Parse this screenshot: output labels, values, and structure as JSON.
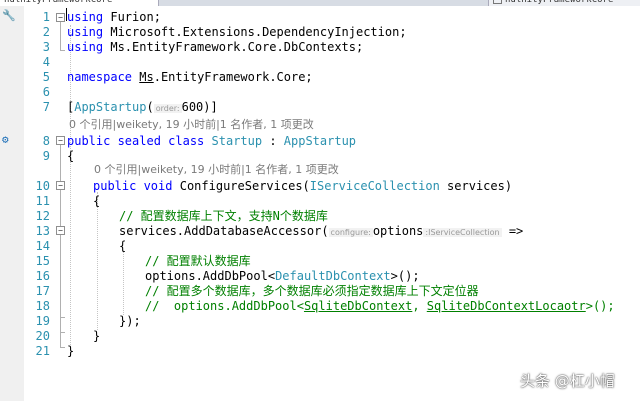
{
  "tabs": {
    "active": "nulnityFrameworkCore",
    "other": "nulnityFrameworkCore"
  },
  "line_numbers": [
    "1",
    "2",
    "3",
    "4",
    "5",
    "6",
    "7",
    "8",
    "9",
    "10",
    "11",
    "12",
    "13",
    "14",
    "15",
    "16",
    "17",
    "18",
    "19",
    "20",
    "21"
  ],
  "code": {
    "l1": {
      "kw": "using",
      "rest": " Furion;"
    },
    "l2": {
      "kw": "using",
      "rest": " Microsoft.Extensions.DependencyInjection;"
    },
    "l3": {
      "kw": "using",
      "rest": " Ms.EntityFramework.Core.DbContexts;"
    },
    "l5": {
      "kw": "namespace",
      "ns": "Ms",
      "rest": ".EntityFramework.Core;"
    },
    "l7": {
      "open": "[",
      "attr": "AppStartup",
      "paren": "(",
      "hint": "order:",
      "value": "600",
      "close": ")]"
    },
    "lens_class": "0 个引用|weikety, 19 小时前|1 名作者, 1 项更改",
    "l8": {
      "mods": "public sealed class",
      "name": "Startup",
      "colon": " : ",
      "base": "AppStartup"
    },
    "l9": "{",
    "lens_method": "0 个引用|weikety, 19 小时前|1 名作者, 1 项更改",
    "l10": {
      "mods": "public void",
      "name": "ConfigureServices",
      "open": "(",
      "ptype": "IServiceCollection",
      "pname": " services)"
    },
    "l11": "{",
    "l12": "// 配置数据库上下文，支持N个数据库",
    "l13": {
      "pre": "services.",
      "method": "AddDatabaseAccessor",
      "open": "(",
      "hint1": "configure:",
      "param": "options",
      "hint2": ":IServiceCollection",
      "arrow": " =>"
    },
    "l14": "{",
    "l15": "// 配置默认数据库",
    "l16": {
      "pre": "options.",
      "method": "AddDbPool",
      "lt": "<",
      "type": "DefaultDbContext",
      "gt": ">();"
    },
    "l17": "// 配置多个数据库，多个数据库必须指定数据库上下文定位器",
    "l18": {
      "pre": "//  options.AddDbPool<",
      "t1": "SqliteDbContext",
      "mid": ", ",
      "t2": "SqliteDbContextLocaotr",
      "end": ">();"
    },
    "l19": "});",
    "l20": "}",
    "l21": "}"
  },
  "icons": {
    "margin_top": "wrench-icon",
    "margin_class": "gear-icon"
  },
  "watermark": "头条 @杠小帽"
}
